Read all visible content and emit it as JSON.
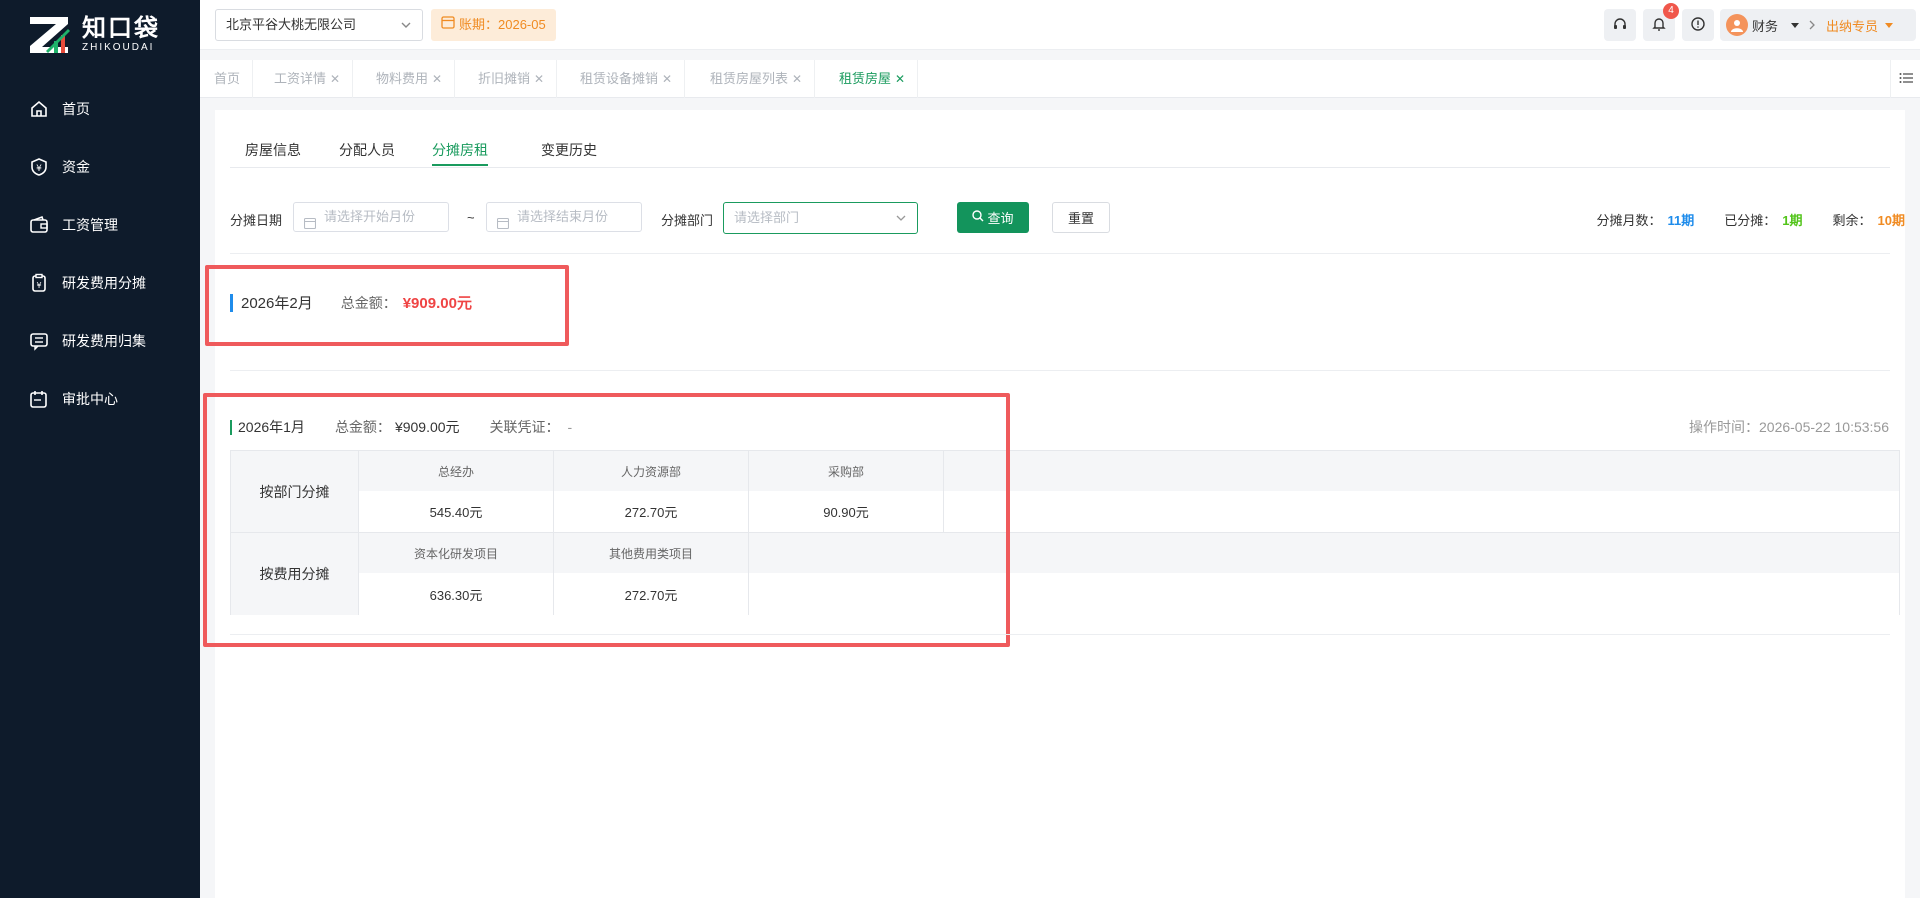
{
  "logo": {
    "cn": "知口袋",
    "en": "ZHIKOUDAI"
  },
  "sidebar": {
    "items": [
      {
        "label": "首页",
        "icon": "home-icon"
      },
      {
        "label": "资金",
        "icon": "yen-shield-icon"
      },
      {
        "label": "工资管理",
        "icon": "wallet-icon"
      },
      {
        "label": "研发费用分摊",
        "icon": "clipboard-yen-icon"
      },
      {
        "label": "研发费用归集",
        "icon": "chat-box-icon"
      },
      {
        "label": "审批中心",
        "icon": "calendar-edit-icon"
      }
    ]
  },
  "header": {
    "company": "北京平谷大桃无限公司",
    "period": "账期：2026-05",
    "notification_count": "4",
    "user_name": "财务",
    "role": "出纳专员"
  },
  "tabs": [
    {
      "label": "首页",
      "closable": false
    },
    {
      "label": "工资详情",
      "closable": true
    },
    {
      "label": "物料费用",
      "closable": true
    },
    {
      "label": "折旧摊销",
      "closable": true
    },
    {
      "label": "租赁设备摊销",
      "closable": true
    },
    {
      "label": "租赁房屋列表",
      "closable": true
    },
    {
      "label": "租赁房屋",
      "closable": true,
      "active": true
    }
  ],
  "subtabs": [
    "房屋信息",
    "分配人员",
    "分摊房租",
    "变更历史"
  ],
  "active_subtab": "分摊房租",
  "filters": {
    "date_label": "分摊日期",
    "start_placeholder": "请选择开始月份",
    "separator": "~",
    "end_placeholder": "请选择结束月份",
    "dept_label": "分摊部门",
    "dept_placeholder": "请选择部门",
    "query_button": "查询",
    "reset_button": "重置"
  },
  "stats": {
    "months_label": "分摊月数：",
    "months_value": "11期",
    "done_label": "已分摊：",
    "done_value": "1期",
    "remaining_label": "剩余：",
    "remaining_value": "10期"
  },
  "feb": {
    "month": "2026年2月",
    "total_label": "总金额：",
    "total_value": "¥909.00元"
  },
  "jan": {
    "month": "2026年1月",
    "total_label": "总金额：",
    "total_value": "¥909.00元",
    "voucher_label": "关联凭证：",
    "voucher_value": "-",
    "op_time_label": "操作时间：",
    "op_time_value": "2026-05-22 10:53:56",
    "by_dept_label": "按部门分摊",
    "by_dept": [
      {
        "name": "总经办",
        "amount": "545.40元"
      },
      {
        "name": "人力资源部",
        "amount": "272.70元"
      },
      {
        "name": "采购部",
        "amount": "90.90元"
      }
    ],
    "by_cost_label": "按费用分摊",
    "by_cost": [
      {
        "name": "资本化研发项目",
        "amount": "636.30元"
      },
      {
        "name": "其他费用类项目",
        "amount": "272.70元"
      }
    ]
  },
  "colors": {
    "sidebar": "#0e1b2b",
    "accent": "#1a9b5e",
    "highlight_red": "#ef5a5c",
    "blue": "#1f8ceb",
    "orange": "#f08b22"
  }
}
